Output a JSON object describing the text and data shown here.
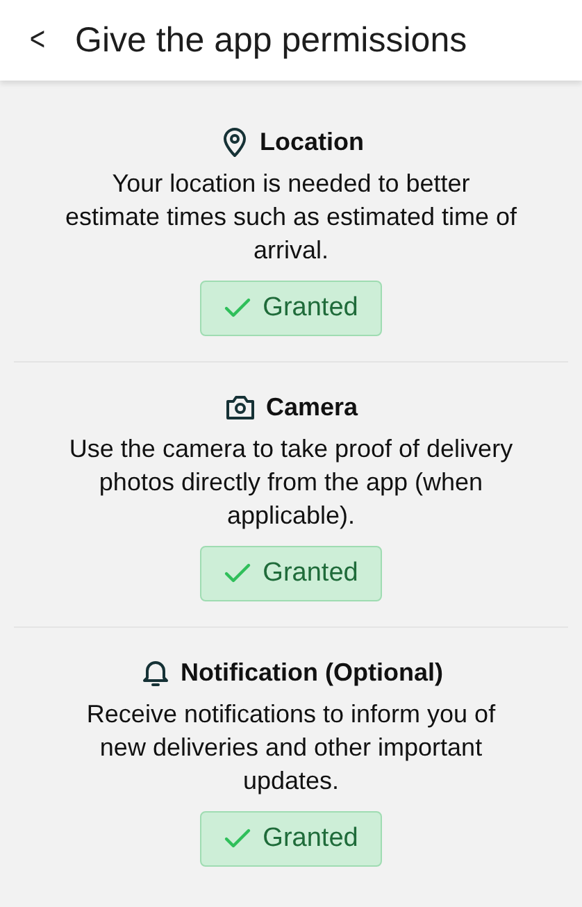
{
  "header": {
    "back": "<",
    "title": "Give the app permissions"
  },
  "permissions": [
    {
      "kind": "location",
      "title": "Location",
      "description": "Your location is needed to better estimate times such as estimated time of arrival.",
      "status": "Granted",
      "granted": true
    },
    {
      "kind": "camera",
      "title": "Camera",
      "description": "Use the camera to take proof of delivery photos directly from the app (when applicable).",
      "status": "Granted",
      "granted": true
    },
    {
      "kind": "notification",
      "title": "Notification (Optional)",
      "description": "Receive notifications to inform you of new deliveries and other important updates.",
      "status": "Granted",
      "granted": true
    }
  ]
}
